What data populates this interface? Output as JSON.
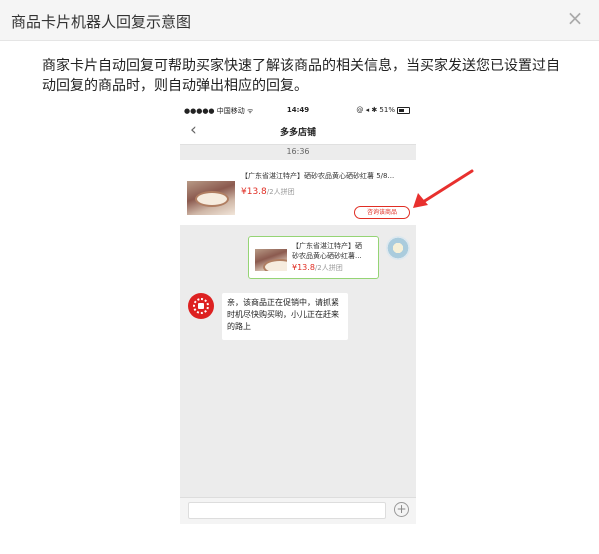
{
  "dialog": {
    "title": "商品卡片机器人回复示意图",
    "close_icon": "×",
    "description": "商家卡片自动回复可帮助买家快速了解该商品的相关信息，当买家发送您已设置过自动回复的商品时，则自动弹出相应的回复。"
  },
  "phone": {
    "status_bar": {
      "carrier": "●●●●● 中国移动 ᯤ",
      "time": "14:49",
      "right": "@ ◂ ✱ 51%"
    },
    "nav": {
      "back_icon": "‹",
      "title": "多多店铺"
    },
    "chat_time": "16:36",
    "product_card": {
      "title": "【广东省湛江特产】硒砂农品黄心硒砂红薯 5/8...",
      "price": "¥13.8",
      "sub": "/2人拼团",
      "consult_label": "咨询该商品"
    },
    "sent_card": {
      "title_line1": "【广东省湛江特产】硒",
      "title_line2": "砂农品黄心硒砂红薯...",
      "price": "¥13.8",
      "sub": "/2人拼团"
    },
    "reply": {
      "text": "亲，该商品正在促销中，请抓紧时机尽快购买哟，小儿正在赶来的路上"
    },
    "input": {
      "value": "",
      "plus_icon": "+"
    }
  },
  "annotation": {
    "arrow_color": "#e8302e"
  }
}
